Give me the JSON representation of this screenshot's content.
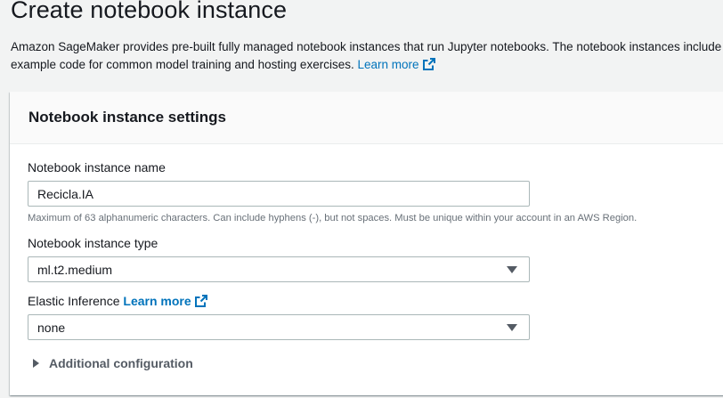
{
  "page": {
    "title": "Create notebook instance",
    "description": "Amazon SageMaker provides pre-built fully managed notebook instances that run Jupyter notebooks. The notebook instances include example code for common model training and hosting exercises.",
    "learn_more": "Learn more"
  },
  "settings": {
    "title": "Notebook instance settings",
    "name_label": "Notebook instance name",
    "name_value": "Recicla.IA",
    "name_hint": "Maximum of 63 alphanumeric characters. Can include hyphens (-), but not spaces. Must be unique within your account in an AWS Region.",
    "type_label": "Notebook instance type",
    "type_value": "ml.t2.medium",
    "inference_label": "Elastic Inference",
    "inference_learn_more": "Learn more",
    "inference_value": "none",
    "additional_config": "Additional configuration"
  },
  "colors": {
    "link": "#0073bb",
    "background": "#f2f3f3",
    "panel_header": "#fafafa",
    "border": "#aab7b8"
  }
}
